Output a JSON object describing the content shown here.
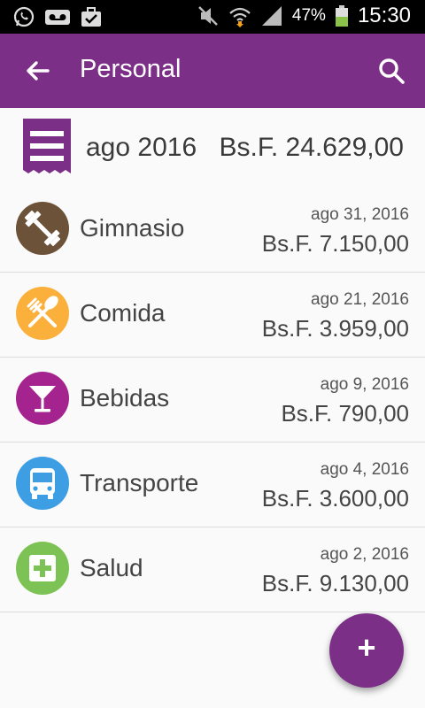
{
  "status_bar": {
    "battery_percent": "47%",
    "time": "15:30",
    "icons": [
      "whatsapp-icon",
      "voicemail-icon",
      "briefcase-check-icon",
      "mute-icon",
      "wifi-icon",
      "signal-icon",
      "battery-icon"
    ]
  },
  "app_bar": {
    "title": "Personal",
    "back_icon": "arrow-back-icon",
    "search_icon": "search-icon",
    "color": "#7b2f86"
  },
  "summary": {
    "month": "ago 2016",
    "total": "Bs.F. 24.629,00",
    "icon": "receipt-icon"
  },
  "items": [
    {
      "category": "Gimnasio",
      "date": "ago 31, 2016",
      "amount": "Bs.F. 7.150,00",
      "icon": "dumbbell-icon",
      "color": "#6b5238"
    },
    {
      "category": "Comida",
      "date": "ago 21, 2016",
      "amount": "Bs.F. 3.959,00",
      "icon": "utensils-icon",
      "color": "#fbb03b"
    },
    {
      "category": "Bebidas",
      "date": "ago 9, 2016",
      "amount": "Bs.F. 790,00",
      "icon": "cocktail-icon",
      "color": "#a4238f"
    },
    {
      "category": "Transporte",
      "date": "ago 4, 2016",
      "amount": "Bs.F. 3.600,00",
      "icon": "bus-icon",
      "color": "#3d9ee4"
    },
    {
      "category": "Salud",
      "date": "ago 2, 2016",
      "amount": "Bs.F. 9.130,00",
      "icon": "medical-cross-icon",
      "color": "#7dc254"
    }
  ],
  "fab": {
    "label": "+",
    "icon": "add-icon",
    "color": "#7b2f86"
  }
}
